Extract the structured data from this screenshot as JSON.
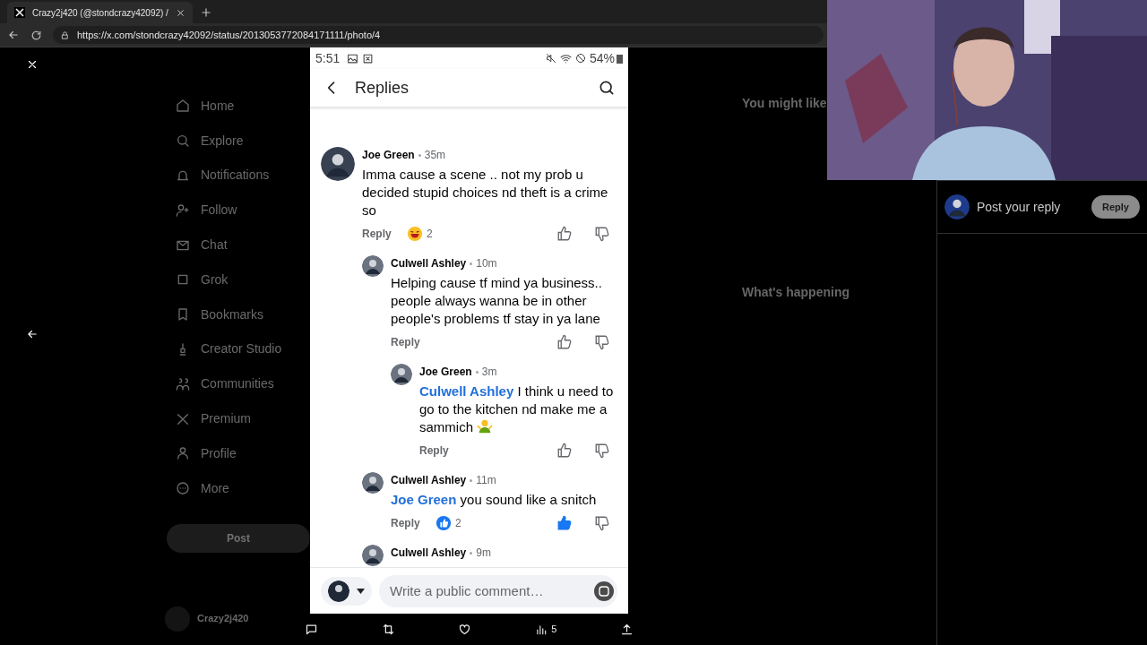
{
  "browser": {
    "tab": {
      "title": "Crazy2j420 (@stondcrazy42092) /",
      "selected": true
    },
    "url": "https://x.com/stondcrazy42092/status/2013053772084171111/photo/4"
  },
  "x_sidebar": {
    "items": [
      "Home",
      "Explore",
      "Notifications",
      "Follow",
      "Chat",
      "Grok",
      "Bookmarks",
      "Creator Studio",
      "Communities",
      "Premium",
      "Profile",
      "More"
    ],
    "post_button": "Post",
    "account": "Crazy2j420"
  },
  "x_right": {
    "sections": [
      "You might like",
      "What's happening"
    ]
  },
  "phone": {
    "status": {
      "time": "5:51",
      "battery": "54%"
    },
    "header": {
      "title": "Replies"
    },
    "comments": [
      {
        "author": "Joe Green",
        "time": "35m",
        "text": "Imma cause a scene .. not my prob u decided stupid choices nd theft is a crime so",
        "reply": "Reply",
        "reaction": {
          "kind": "haha",
          "count": "2"
        },
        "liked": false,
        "children": [
          {
            "author": "Culwell Ashley",
            "time": "10m",
            "text": "Helping cause tf mind ya business.. people always wanna be in other people's problems tf stay in ya lane",
            "reply": "Reply",
            "liked": false,
            "children": [
              {
                "author": "Joe Green",
                "time": "3m",
                "mention": "Culwell Ashley",
                "text": "I think u need to go to the kitchen nd make me a sammich",
                "emoji": true,
                "reply": "Reply",
                "liked": false
              }
            ]
          },
          {
            "author": "Culwell Ashley",
            "time": "11m",
            "mention": "Joe Green",
            "text": "you sound like a snitch",
            "reply": "Reply",
            "reaction": {
              "kind": "like",
              "count": "2"
            },
            "liked": true
          },
          {
            "author": "Culwell Ashley",
            "time": "9m"
          }
        ]
      }
    ],
    "composer": {
      "placeholder": "Write a public comment…"
    }
  },
  "action_bar": {
    "views": "5"
  },
  "reply_panel": {
    "placeholder": "Post your reply",
    "button": "Reply"
  }
}
